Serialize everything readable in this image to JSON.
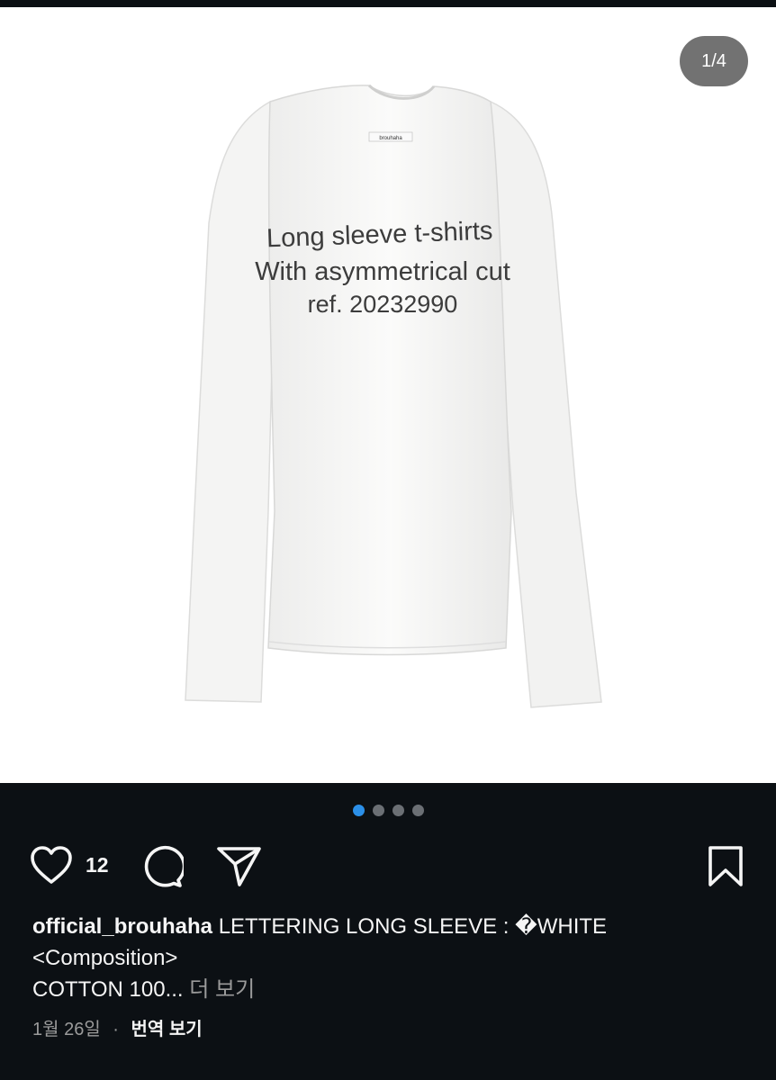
{
  "post": {
    "image_counter": "1/4",
    "shirt_label": "brouhaha",
    "print_text": {
      "line1": "Long sleeve t-shirts",
      "line2": "With asymmetrical cut",
      "line3": "ref. 20232990"
    },
    "carousel": {
      "total": 4,
      "active_index": 0
    },
    "like_count": "12",
    "caption": {
      "username": "official_brouhaha",
      "line1": "LETTERING LONG SLEEVE : �WHITE",
      "line2": "<Composition>",
      "line3": "COTTON 100...",
      "more_label": "더 보기"
    },
    "date": "1월 26일",
    "separator": "·",
    "translate_label": "번역 보기"
  },
  "icons": {
    "like": "heart-icon",
    "comment": "comment-bubble-icon",
    "share": "paper-plane-icon",
    "save": "bookmark-icon"
  },
  "colors": {
    "background": "#0c1014",
    "text": "#f5f5f5",
    "secondary_text": "#9b9b9b",
    "carousel_active": "#2b8fe8",
    "carousel_inactive": "#6b6f74"
  }
}
